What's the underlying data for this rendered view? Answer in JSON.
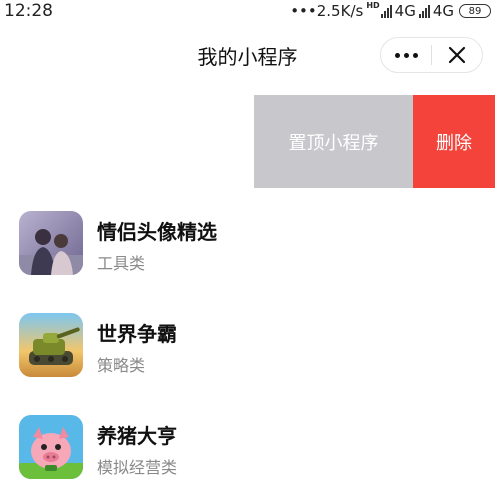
{
  "status_bar": {
    "time": "12:28",
    "network_speed": "•••2.5K/s",
    "hd_label": "HD",
    "network_1": "4G",
    "network_2": "4G",
    "battery": "89"
  },
  "nav": {
    "title": "我的小程序",
    "more_icon": "more-dots-icon",
    "close_icon": "close-icon"
  },
  "swipe_actions": {
    "pin_label": "置顶小程序",
    "delete_label": "删除",
    "pin_color": "#c8c8cc",
    "delete_color": "#f4433b"
  },
  "apps": [
    {
      "name": "情侣头像精选",
      "category": "工具类",
      "icon": "couple-avatar-icon"
    },
    {
      "name": "世界争霸",
      "category": "策略类",
      "icon": "tank-game-icon"
    },
    {
      "name": "养猪大亨",
      "category": "模拟经营类",
      "icon": "pig-game-icon"
    }
  ]
}
